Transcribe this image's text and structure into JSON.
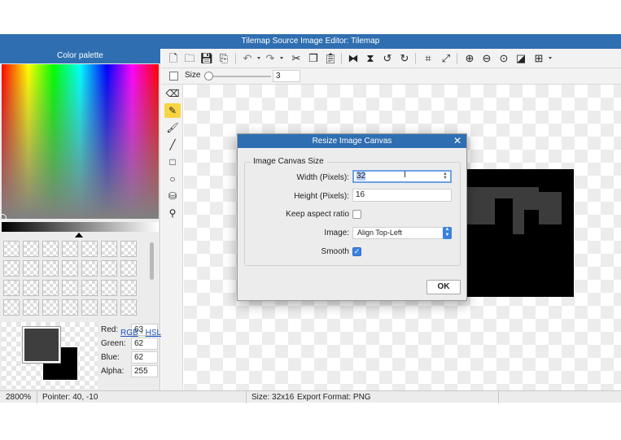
{
  "window": {
    "title": "Tilemap Source Image Editor: Tilemap"
  },
  "palette": {
    "header": "Color palette",
    "swatch_count": 28,
    "foreground_color": "#3f3e3e",
    "background_color": "#000000",
    "rgba": {
      "red_label": "Red:",
      "red": "63",
      "green_label": "Green:",
      "green": "62",
      "blue_label": "Blue:",
      "blue": "62",
      "alpha_label": "Alpha:",
      "alpha": "255"
    },
    "links": {
      "rgb": "RGB",
      "separator": "-",
      "hsl": "HSL"
    }
  },
  "toolbar": {
    "icons": [
      "new-file-icon",
      "open-folder-icon",
      "save-icon",
      "save-as-icon",
      "undo-icon",
      "redo-icon",
      "cut-icon",
      "copy-icon",
      "paste-icon",
      "flip-horizontal-icon",
      "flip-vertical-icon",
      "rotate-left-icon",
      "rotate-right-icon",
      "crop-icon",
      "resize-icon",
      "zoom-in-icon",
      "zoom-out-icon",
      "zoom-fit-icon",
      "toggle-background-icon",
      "grid-icon"
    ]
  },
  "size_bar": {
    "label": "Size",
    "value": "3"
  },
  "tools": [
    "eraser-icon",
    "pencil-icon",
    "brush-icon",
    "line-icon",
    "rectangle-icon",
    "ellipse-icon",
    "fill-icon",
    "eyedropper-icon"
  ],
  "active_tool": "pencil-icon",
  "status": {
    "zoom": "2800%",
    "pointer": "Pointer: 40, -10",
    "size": "Size: 32x16",
    "export_format": "Export Format: PNG"
  },
  "dialog": {
    "title": "Resize Image Canvas",
    "group_label": "Image Canvas Size",
    "width_label": "Width (Pixels):",
    "width_value": "32",
    "height_label": "Height (Pixels):",
    "height_value": "16",
    "keep_aspect_label": "Keep aspect ratio",
    "keep_aspect_checked": false,
    "image_label": "Image:",
    "image_value": "Align Top-Left",
    "smooth_label": "Smooth",
    "smooth_checked": true,
    "ok_label": "OK"
  },
  "colors": {
    "accent": "#2f6fb1",
    "active_tool": "#f8d443",
    "checkbox_on": "#3b82e0"
  }
}
